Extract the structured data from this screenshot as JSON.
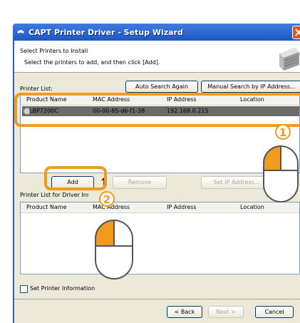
{
  "window": {
    "title": "CAPT Printer Driver - Setup Wizard",
    "header_title": "Select Printers to Install",
    "header_subtitle": "Select the printers to add, and then click [Add]."
  },
  "printer_list": {
    "label": "Printer List:",
    "auto_search_label": "Auto Search Again",
    "manual_search_label": "Manual Search by IP Address...",
    "columns": [
      "Product Name",
      "MAC Address",
      "IP Address",
      "Location"
    ],
    "rows": [
      {
        "product_name": "LBP7200C",
        "mac_address": "00-00-85-d6-f1-38",
        "ip_address": "192.168.0.215",
        "location": ""
      }
    ]
  },
  "actions": {
    "add_label": "Add",
    "remove_label": "Remove",
    "set_ip_label": "Set IP Address..."
  },
  "install_list": {
    "label": "Printer List for Driver Installation:",
    "columns": [
      "Product Name",
      "MAC Address",
      "IP Address",
      "Location"
    ]
  },
  "footer": {
    "set_printer_info_label": "Set Printer Information",
    "back_label": "< Back",
    "next_label": "Next >",
    "cancel_label": "Cancel"
  },
  "annotations": {
    "step1": "1",
    "step2": "2",
    "accent_color": "#f09b1f"
  },
  "icons": [
    "printer-icon",
    "mouse-icon",
    "arrow-up-icon",
    "close-icon"
  ]
}
